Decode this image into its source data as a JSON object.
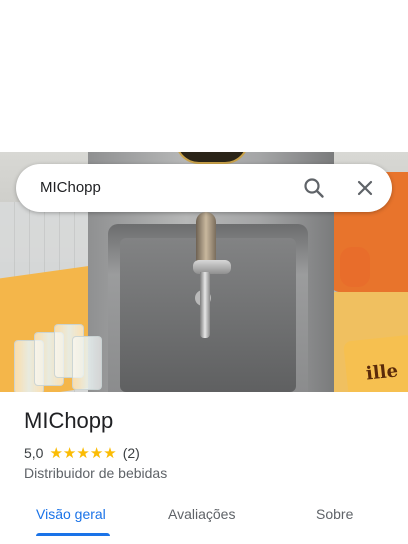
{
  "search": {
    "query": "MIChopp"
  },
  "icons": {
    "search": "search-icon",
    "close": "close-icon",
    "star": "star-icon"
  },
  "place": {
    "name": "MIChopp",
    "rating_value": "5,0",
    "stars": 5,
    "review_count": "(2)",
    "category": "Distribuidor de bebidas"
  },
  "photo_sign_text": "ille",
  "tabs": [
    {
      "label": "Visão geral",
      "active": true
    },
    {
      "label": "Avaliações",
      "active": false
    },
    {
      "label": "Sobre",
      "active": false
    }
  ],
  "colors": {
    "accent": "#1a73e8",
    "star": "#fbbc04",
    "text": "#202124",
    "secondary_text": "#5f6368"
  }
}
